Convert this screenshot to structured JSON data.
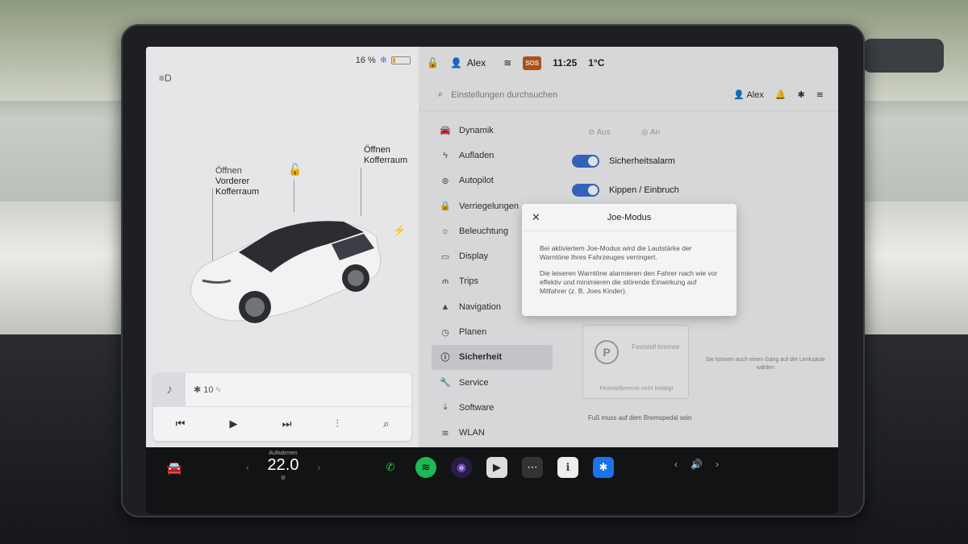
{
  "status_bar": {
    "battery_percent": "16 %",
    "battery_level": 0.16,
    "user": "Alex",
    "time": "11:25",
    "temperature": "1°C",
    "sos_label": "SOS"
  },
  "car_view": {
    "front_trunk_action": "Öffnen",
    "front_trunk_line1": "Vorderer",
    "front_trunk_line2": "Kofferraum",
    "rear_trunk_action": "Öffnen",
    "rear_trunk_label": "Kofferraum"
  },
  "media": {
    "source": "10"
  },
  "search": {
    "placeholder": "Einstellungen durchsuchen",
    "user": "Alex"
  },
  "menu": {
    "items": [
      {
        "label": "Dynamik",
        "icon": "car-icon"
      },
      {
        "label": "Aufladen",
        "icon": "bolt-icon"
      },
      {
        "label": "Autopilot",
        "icon": "steering-wheel-icon"
      },
      {
        "label": "Verriegelungen",
        "icon": "lock-icon"
      },
      {
        "label": "Beleuchtung",
        "icon": "sun-icon"
      },
      {
        "label": "Display",
        "icon": "display-icon"
      },
      {
        "label": "Trips",
        "icon": "trips-icon"
      },
      {
        "label": "Navigation",
        "icon": "navigation-icon"
      },
      {
        "label": "Planen",
        "icon": "clock-icon"
      },
      {
        "label": "Sicherheit",
        "icon": "info-icon"
      },
      {
        "label": "Service",
        "icon": "wrench-icon"
      },
      {
        "label": "Software",
        "icon": "download-icon"
      },
      {
        "label": "WLAN",
        "icon": "wifi-icon"
      }
    ],
    "active": "Sicherheit"
  },
  "content": {
    "faded_left": "Aus",
    "faded_right": "An",
    "toggle1": "Sicherheitsalarm",
    "toggle2": "Kippen / Einbruch",
    "park_label": "Feststell-bremse",
    "park_note": "Feststellbremse nicht betätigt",
    "gear_note": "Sie können auch einen Gang auf der Lenksäule wählen",
    "brake_note": "Fuß muss auf dem Bremspedal sein"
  },
  "modal": {
    "title": "Joe-Modus",
    "paragraph1": "Bei aktiviertem Joe-Modus wird die Lautstärke der Warntöne Ihres Fahrzeuges verringert.",
    "paragraph2": "Die leiseren Warntöne alarmieren den Fahrer nach wie vor effektiv und minimieren die störende Einwirkung auf Mitfahrer (z. B. Joes Kinder)."
  },
  "taskbar": {
    "climate_label": "Aufwärmen",
    "climate_temp": "22.0"
  },
  "colors": {
    "accent": "#3d6ed6",
    "sos": "#c85a1a",
    "phone": "#2ecc40",
    "spotify": "#1db954",
    "bluetooth": "#1a73e8"
  }
}
